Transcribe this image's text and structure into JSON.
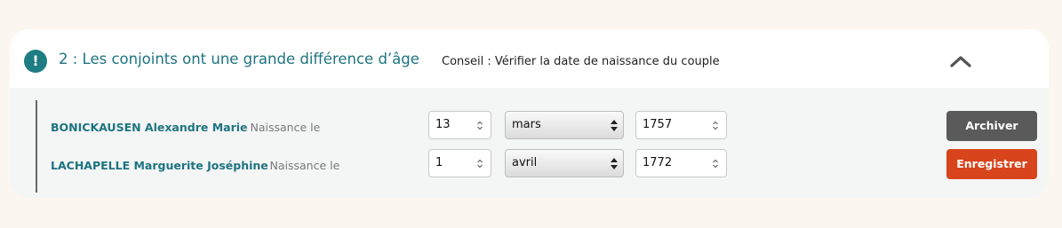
{
  "header": {
    "alert_icon_glyph": "!",
    "title": "2 : Les conjoints ont une grande différence d’âge",
    "advice": "Conseil : Vérifier la date de naissance du couple",
    "collapse_icon": "chevron-up-icon"
  },
  "rows": [
    {
      "name": "BONICKAUSEN Alexandre Marie",
      "naissance_label": " - Naissance le",
      "day": "13",
      "month": "mars",
      "year": "1757",
      "button_label": "Archiver"
    },
    {
      "name": "LACHAPELLE Marguerite Joséphine",
      "naissance_label": " - Naissance le",
      "day": "1",
      "month": "avril",
      "year": "1772",
      "button_label": "Enregistrer"
    }
  ],
  "colors": {
    "accent": "#1d7d82",
    "archive_button": "#5a5a5a",
    "save_button": "#d8451d",
    "page_background": "#fcf6f1"
  }
}
